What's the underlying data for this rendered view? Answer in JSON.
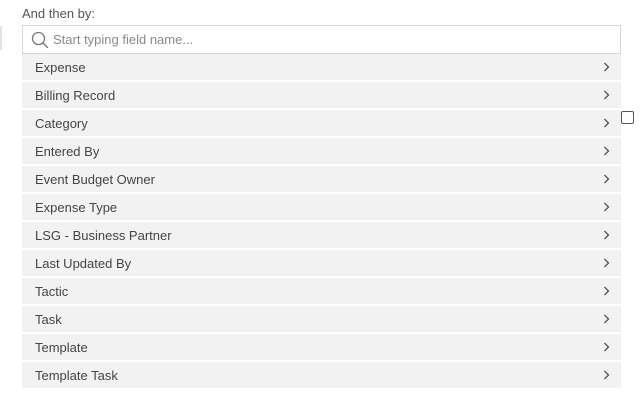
{
  "heading": "And then by:",
  "search": {
    "placeholder": "Start typing field name...",
    "value": ""
  },
  "fields": [
    "Expense",
    "Billing Record",
    "Category",
    "Entered By",
    "Event Budget Owner",
    "Expense Type",
    "LSG - Business Partner",
    "Last Updated By",
    "Tactic",
    "Task",
    "Template",
    "Template Task"
  ],
  "icons": {
    "search": "search-icon",
    "item": "chevron-right-icon"
  },
  "colors": {
    "row_bg": "#f2f2f2",
    "text": "#444444",
    "border": "#d6d6d6"
  }
}
